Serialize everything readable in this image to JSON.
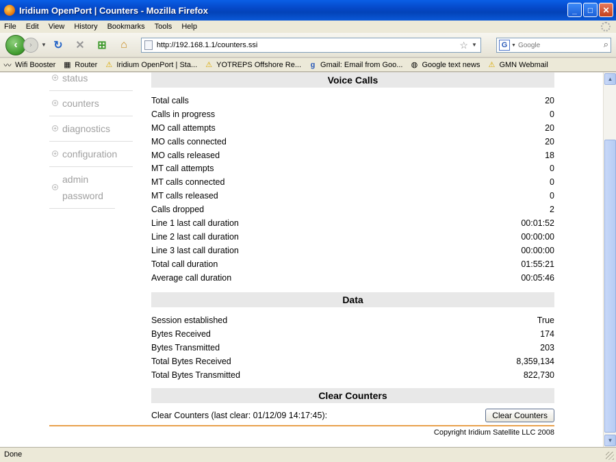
{
  "window": {
    "title": "Iridium OpenPort | Counters - Mozilla Firefox"
  },
  "menu": [
    "File",
    "Edit",
    "View",
    "History",
    "Bookmarks",
    "Tools",
    "Help"
  ],
  "nav": {
    "url": "http://192.168.1.1/counters.ssi",
    "search_placeholder": "Google"
  },
  "bookmarks": [
    {
      "label": "Wifi Booster",
      "icon": "wifi-icon"
    },
    {
      "label": "Router",
      "icon": "router-icon"
    },
    {
      "label": "Iridium OpenPort | Sta...",
      "icon": "warning-icon"
    },
    {
      "label": "YOTREPS Offshore Re...",
      "icon": "warning-icon"
    },
    {
      "label": "Gmail: Email from Goo...",
      "icon": "google-icon"
    },
    {
      "label": "Google text news",
      "icon": "news-icon"
    },
    {
      "label": "GMN Webmail",
      "icon": "warning-icon"
    }
  ],
  "sidebar": {
    "items": [
      "status",
      "counters",
      "diagnostics",
      "configuration",
      "admin password"
    ]
  },
  "voice": {
    "title": "Voice Calls",
    "rows": [
      {
        "label": "Total calls",
        "value": "20"
      },
      {
        "label": "Calls in progress",
        "value": "0"
      },
      {
        "label": "MO call attempts",
        "value": "20"
      },
      {
        "label": "MO calls connected",
        "value": "20"
      },
      {
        "label": "MO calls released",
        "value": "18"
      },
      {
        "label": "MT call attempts",
        "value": "0"
      },
      {
        "label": "MT calls connected",
        "value": "0"
      },
      {
        "label": "MT calls released",
        "value": "0"
      },
      {
        "label": "Calls dropped",
        "value": "2"
      },
      {
        "label": "Line 1 last call duration",
        "value": "00:01:52"
      },
      {
        "label": "Line 2 last call duration",
        "value": "00:00:00"
      },
      {
        "label": "Line 3 last call duration",
        "value": "00:00:00"
      },
      {
        "label": "Total call duration",
        "value": "01:55:21"
      },
      {
        "label": "Average call duration",
        "value": "00:05:46"
      }
    ]
  },
  "data": {
    "title": "Data",
    "rows": [
      {
        "label": "Session established",
        "value": "True"
      },
      {
        "label": "Bytes Received",
        "value": "174"
      },
      {
        "label": "Bytes Transmitted",
        "value": "203"
      },
      {
        "label": "Total Bytes Received",
        "value": "8,359,134"
      },
      {
        "label": "Total Bytes Transmitted",
        "value": "822,730"
      }
    ]
  },
  "clear": {
    "title": "Clear Counters",
    "label": "Clear Counters (last clear: 01/12/09 14:17:45):",
    "button": "Clear Counters"
  },
  "footer": {
    "copyright": "Copyright Iridium Satellite LLC 2008"
  },
  "status": {
    "text": "Done"
  }
}
